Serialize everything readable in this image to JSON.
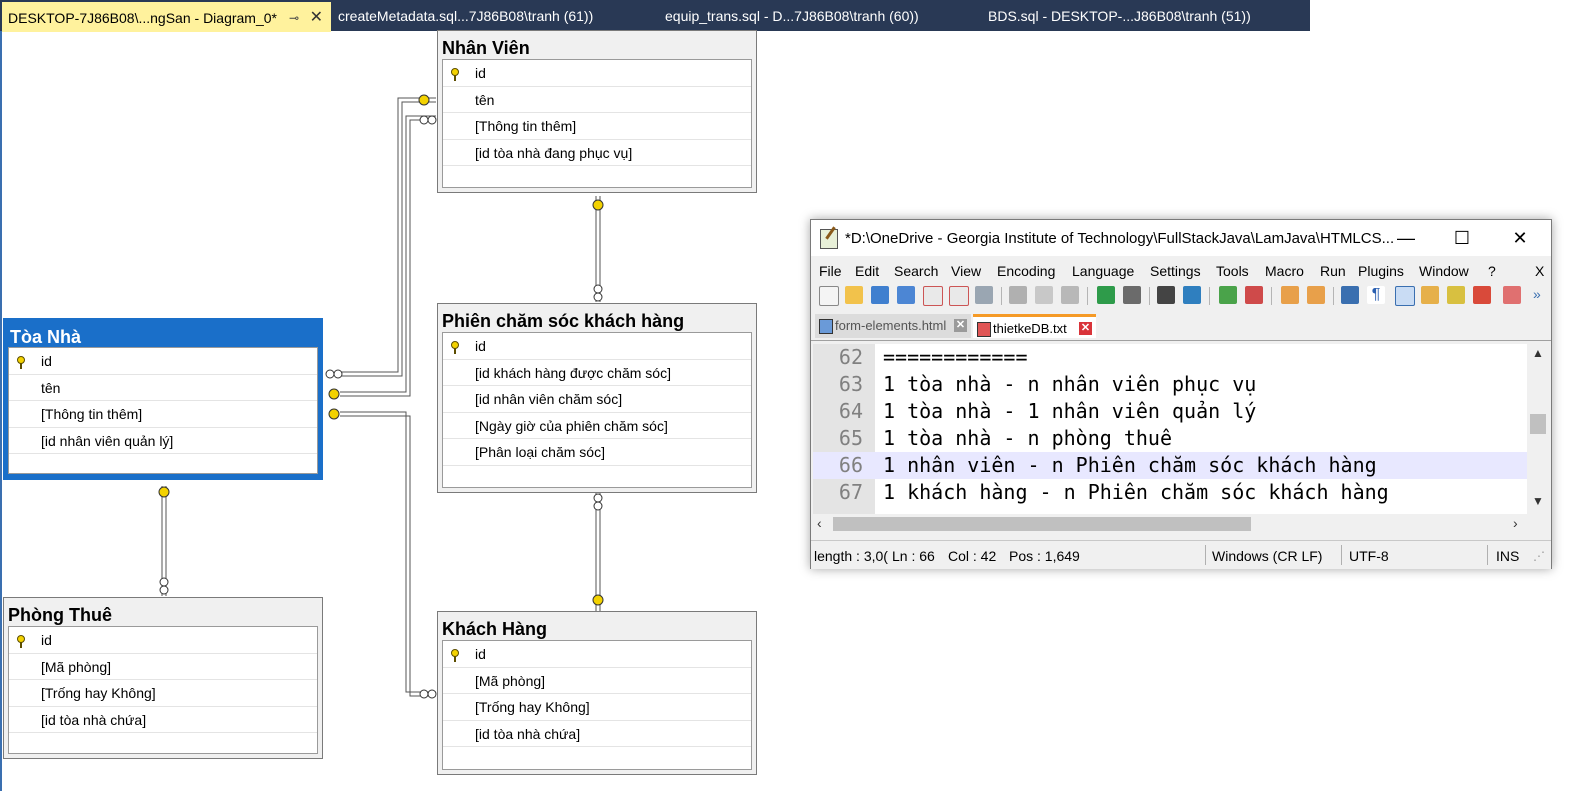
{
  "ssms_tabs": [
    {
      "label": "DESKTOP-7J86B08\\...ngSan - Diagram_0*",
      "active": true
    },
    {
      "label": "createMetadata.sql...7J86B08\\tranh (61))",
      "active": false
    },
    {
      "label": "equip_trans.sql - D...7J86B08\\tranh (60))",
      "active": false
    },
    {
      "label": "BDS.sql - DESKTOP-...J86B08\\tranh (51))",
      "active": false
    }
  ],
  "tables": {
    "nhan_vien": {
      "title": "Nhân Viên",
      "columns": [
        "id",
        "tên",
        "[Thông tin thêm]",
        "[id tòa nhà đang phục vụ]"
      ]
    },
    "phien": {
      "title": "Phiên chăm sóc khách hàng",
      "columns": [
        "id",
        "[id khách hàng được chăm sóc]",
        "[id nhân viên chăm sóc]",
        "[Ngày giờ của phiên chăm sóc]",
        "[Phân loại chăm sóc]"
      ]
    },
    "toa_nha": {
      "title": "Tòa Nhà",
      "columns": [
        "id",
        "tên",
        "[Thông tin thêm]",
        "[id nhân viên quản lý]"
      ]
    },
    "phong_thue": {
      "title": "Phòng Thuê",
      "columns": [
        "id",
        "[Mã phòng]",
        "[Trống hay Không]",
        "[id tòa nhà chứa]"
      ]
    },
    "khach_hang": {
      "title": "Khách Hàng",
      "columns": [
        "id",
        "[Mã phòng]",
        "[Trống hay Không]",
        "[id tòa nhà chứa]"
      ]
    }
  },
  "npp": {
    "title": "*D:\\OneDrive - Georgia Institute of Technology\\FullStackJava\\LamJava\\HTMLCS...",
    "menu": [
      "File",
      "Edit",
      "Search",
      "View",
      "Encoding",
      "Language",
      "Settings",
      "Tools",
      "Macro",
      "Run",
      "Plugins",
      "Window",
      "?",
      "X"
    ],
    "doc_tabs": [
      {
        "label": "form-elements.html",
        "active": false
      },
      {
        "label": "thietkeDB.txt",
        "active": true
      }
    ],
    "lines": [
      {
        "num": "62",
        "text": "============"
      },
      {
        "num": "63",
        "text": "1 tòa nhà - n nhân viên phục vụ"
      },
      {
        "num": "64",
        "text": "1 tòa nhà - 1 nhân viên quản lý"
      },
      {
        "num": "65",
        "text": "1 tòa nhà - n phòng thuê"
      },
      {
        "num": "66",
        "text": "1 nhân viên - n Phiên chăm sóc khách hàng"
      },
      {
        "num": "67",
        "text": "1 khách hàng - n Phiên chăm sóc khách hàng"
      }
    ],
    "status": {
      "length": "length : 3,0(",
      "ln": "Ln : 66",
      "col": "Col : 42",
      "pos": "Pos : 1,649",
      "eol": "Windows (CR LF)",
      "encoding": "UTF-8",
      "mode": "INS"
    }
  },
  "colors": {
    "ssms_tab_bar": "#293955",
    "active_tab": "#fff29d",
    "selected_table": "#1a6fc9",
    "connector_key": "#f3d200"
  }
}
